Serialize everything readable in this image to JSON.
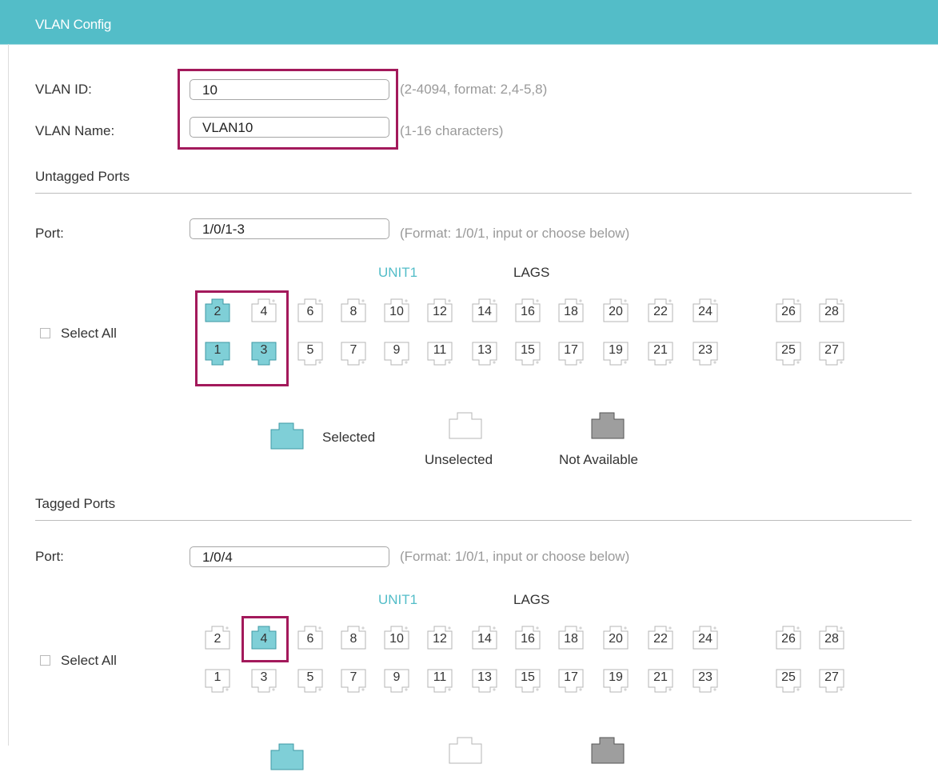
{
  "header": {
    "title": "VLAN Config"
  },
  "vlan_id": {
    "label": "VLAN ID:",
    "value": "10",
    "hint": "(2-4094, format: 2,4-5,8)"
  },
  "vlan_name": {
    "label": "VLAN Name:",
    "value": "VLAN10",
    "hint": "(1-16 characters)"
  },
  "untagged": {
    "title": "Untagged Ports",
    "port_label": "Port:",
    "port_value": "1/0/1-3",
    "port_hint": "(Format: 1/0/1, input or choose below)",
    "tabs": [
      "UNIT1",
      "LAGS"
    ],
    "active_tab": "UNIT1",
    "select_all": "Select All",
    "top_ports": [
      "2",
      "4",
      "6",
      "8",
      "10",
      "12",
      "14",
      "16",
      "18",
      "20",
      "22",
      "24",
      "26",
      "28"
    ],
    "bottom_ports": [
      "1",
      "3",
      "5",
      "7",
      "9",
      "11",
      "13",
      "15",
      "17",
      "19",
      "21",
      "23",
      "25",
      "27"
    ],
    "selected_ports": [
      "1",
      "2",
      "3"
    ]
  },
  "legend": {
    "selected": "Selected",
    "unselected": "Unselected",
    "not_available": "Not Available"
  },
  "tagged": {
    "title": "Tagged Ports",
    "port_label": "Port:",
    "port_value": "1/0/4",
    "port_hint": "(Format: 1/0/1, input or choose below)",
    "tabs": [
      "UNIT1",
      "LAGS"
    ],
    "active_tab": "UNIT1",
    "select_all": "Select All",
    "top_ports": [
      "2",
      "4",
      "6",
      "8",
      "10",
      "12",
      "14",
      "16",
      "18",
      "20",
      "22",
      "24",
      "26",
      "28"
    ],
    "bottom_ports": [
      "1",
      "3",
      "5",
      "7",
      "9",
      "11",
      "13",
      "15",
      "17",
      "19",
      "21",
      "23",
      "25",
      "27"
    ],
    "selected_ports": [
      "4"
    ]
  },
  "colors": {
    "header_bg": "#53bdc8",
    "accent": "#53bdc8",
    "selected_fill": "#7fcfd7",
    "not_available_fill": "#9e9e9e",
    "highlight": "#a3195b",
    "port_border": "#999999"
  },
  "icons": {
    "port_selected": "port-selected-icon",
    "port_unselected": "port-unselected-icon",
    "port_not_available": "port-not-available-icon",
    "checkbox": "checkbox-icon"
  }
}
